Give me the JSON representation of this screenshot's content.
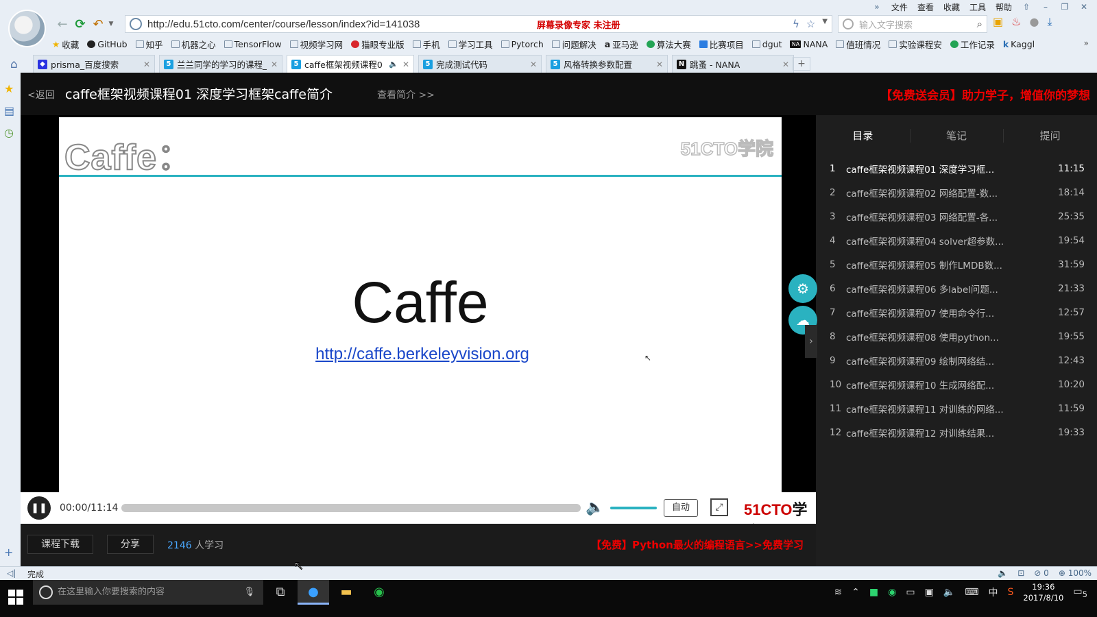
{
  "menubar": {
    "items": [
      "文件",
      "查看",
      "收藏",
      "工具",
      "帮助"
    ]
  },
  "address_bar": {
    "url": "http://edu.51cto.com/center/course/lesson/index?id=141038",
    "recorder_notice": "屏幕录像专家  未注册"
  },
  "search": {
    "placeholder": "输入文字搜索"
  },
  "bookmarks": [
    {
      "label": "收藏",
      "icon": "star-icon"
    },
    {
      "label": "GitHub",
      "icon": "github-icon"
    },
    {
      "label": "知乎",
      "icon": "page-icon"
    },
    {
      "label": "机器之心",
      "icon": "page-icon"
    },
    {
      "label": "TensorFlow",
      "icon": "folder-icon"
    },
    {
      "label": "视频学习网",
      "icon": "folder-icon"
    },
    {
      "label": "猫眼专业版",
      "icon": "maoyan-icon"
    },
    {
      "label": "手机",
      "icon": "folder-icon"
    },
    {
      "label": "学习工具",
      "icon": "folder-icon"
    },
    {
      "label": "Pytorch",
      "icon": "folder-icon"
    },
    {
      "label": "问题解决",
      "icon": "folder-icon"
    },
    {
      "label": "亚马逊",
      "icon": "amazon-icon"
    },
    {
      "label": "算法大赛",
      "icon": "page-icon"
    },
    {
      "label": "比赛项目",
      "icon": "page-icon"
    },
    {
      "label": "dgut",
      "icon": "page-icon"
    },
    {
      "label": "NANA",
      "icon": "nana-icon"
    },
    {
      "label": "值班情况",
      "icon": "page-icon"
    },
    {
      "label": "实验课程安",
      "icon": "page-icon"
    },
    {
      "label": "工作记录",
      "icon": "page-icon"
    },
    {
      "label": "Kaggl",
      "icon": "kaggle-icon"
    }
  ],
  "tabs": [
    {
      "label": "prisma_百度搜索",
      "favicon": "baidu"
    },
    {
      "label": "兰兰同学的学习的课程_",
      "favicon": "51cto"
    },
    {
      "label": "caffe框架视频课程0",
      "favicon": "51cto",
      "active": true
    },
    {
      "label": "完成测试代码",
      "favicon": "51cto"
    },
    {
      "label": "风格转换参数配置",
      "favicon": "51cto"
    },
    {
      "label": "跳蚤 - NANA",
      "favicon": "nana"
    }
  ],
  "page": {
    "back": "<返回",
    "title": "caffe框架视频课程01 深度学习框架caffe简介",
    "intro_link": "查看简介 >>",
    "promo_top": "【免费送会员】助力学子，增值你的梦想"
  },
  "slide": {
    "heading": "Caffe：",
    "watermark": "51CTO学院",
    "title": "Caffe",
    "link": "http://caffe.berkeleyvision.org"
  },
  "player": {
    "time": "00:00/11:14",
    "progress": 0,
    "volume": 1.0,
    "quality": "自动",
    "logo_red": "51CTO",
    "logo_dark": "学院"
  },
  "below": {
    "download": "课程下载",
    "share": "分享",
    "learners_count": "2146",
    "learners_suffix": " 人学习",
    "promo": "【免费】Python最火的编程语言>>免费学习"
  },
  "playlist": {
    "tabs": [
      "目录",
      "笔记",
      "提问"
    ],
    "items": [
      {
        "idx": "1",
        "title": "caffe框架视频课程01 深度学习框...",
        "dur": "11:15"
      },
      {
        "idx": "2",
        "title": "caffe框架视频课程02 网络配置-数...",
        "dur": "18:14"
      },
      {
        "idx": "3",
        "title": "caffe框架视频课程03 网络配置-各...",
        "dur": "25:35"
      },
      {
        "idx": "4",
        "title": "caffe框架视频课程04 solver超参数...",
        "dur": "19:54"
      },
      {
        "idx": "5",
        "title": "caffe框架视频课程05 制作LMDB数...",
        "dur": "31:59"
      },
      {
        "idx": "6",
        "title": "caffe框架视频课程06 多label问题...",
        "dur": "21:33"
      },
      {
        "idx": "7",
        "title": "caffe框架视频课程07 使用命令行...",
        "dur": "12:57"
      },
      {
        "idx": "8",
        "title": "caffe框架视频课程08 使用python...",
        "dur": "19:55"
      },
      {
        "idx": "9",
        "title": "caffe框架视频课程09 绘制网络结...",
        "dur": "12:43"
      },
      {
        "idx": "10",
        "title": "caffe框架视频课程10 生成网络配...",
        "dur": "10:20"
      },
      {
        "idx": "11",
        "title": "caffe框架视频课程11 对训练的网络...",
        "dur": "11:59"
      },
      {
        "idx": "12",
        "title": "caffe框架视频课程12 对训练结果...",
        "dur": "19:33"
      }
    ]
  },
  "statusbar": {
    "left": "完成",
    "badge": "0",
    "zoom": "100%"
  },
  "taskbar": {
    "search_placeholder": "在这里输入你要搜索的内容",
    "ime": "中",
    "time": "19:36",
    "date": "2017/8/10",
    "notifications": "5"
  }
}
